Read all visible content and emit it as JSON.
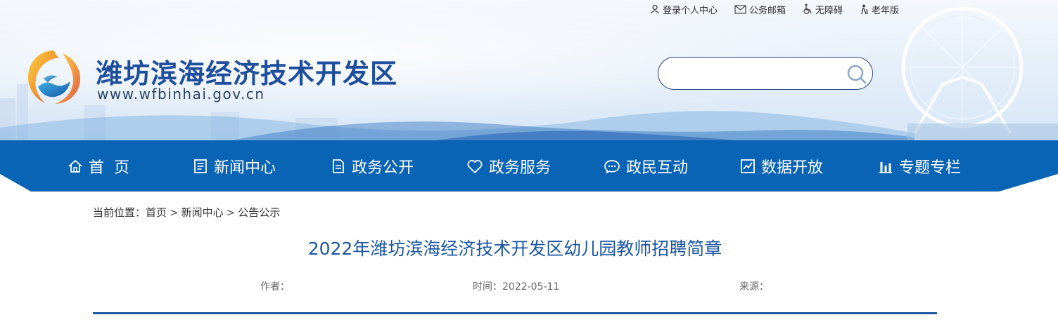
{
  "top_links": [
    {
      "label": "登录个人中心",
      "icon": "user-icon"
    },
    {
      "label": "公务邮箱",
      "icon": "mail-icon"
    },
    {
      "label": "无障碍",
      "icon": "wheelchair-icon"
    },
    {
      "label": "老年版",
      "icon": "elder-icon"
    }
  ],
  "site": {
    "title": "潍坊滨海经济技术开发区",
    "url": "www.wfbinhai.gov.cn"
  },
  "search": {
    "value": "",
    "placeholder": ""
  },
  "nav": [
    {
      "label": "首  页",
      "icon": "home-icon"
    },
    {
      "label": "新闻中心",
      "icon": "news-icon"
    },
    {
      "label": "政务公开",
      "icon": "document-icon"
    },
    {
      "label": "政务服务",
      "icon": "heart-icon"
    },
    {
      "label": "政民互动",
      "icon": "chat-icon"
    },
    {
      "label": "数据开放",
      "icon": "data-chart-icon"
    },
    {
      "label": "专题专栏",
      "icon": "bar-chart-icon"
    }
  ],
  "breadcrumb": {
    "prefix": "当前位置：",
    "items": [
      "首页",
      "新闻中心",
      "公告公示"
    ],
    "separator": ">"
  },
  "article": {
    "title": "2022年潍坊滨海经济技术开发区幼儿园教师招聘简章",
    "author": "作者：",
    "time": "时间：2022-05-11",
    "source": "来源："
  },
  "colors": {
    "brand_blue": "#0a64b5",
    "title_blue": "#1f4e9c",
    "article_blue": "#1b56a3"
  }
}
